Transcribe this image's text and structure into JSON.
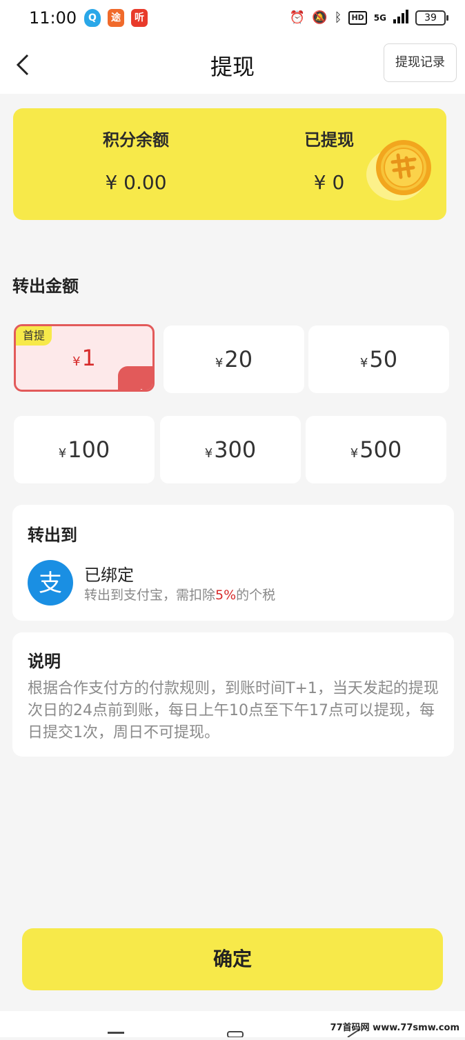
{
  "status_bar": {
    "time": "11:00",
    "apps": [
      {
        "label": "Q",
        "color": "#2aa7e8"
      },
      {
        "label": "途",
        "color": "#f06a2b"
      },
      {
        "label": "听",
        "color": "#e83a2b"
      }
    ],
    "hd": "HD",
    "network": "5G",
    "battery": "39"
  },
  "nav": {
    "title": "提现",
    "record_button": "提现记录"
  },
  "balance": {
    "points_label": "积分余额",
    "points_value": "¥ 0.00",
    "withdrawn_label": "已提现",
    "withdrawn_value": "¥ 0",
    "card_color": "#f7e94a"
  },
  "amount_section": {
    "title": "转出金额",
    "currency": "¥",
    "first_tag": "首提",
    "options": [
      "1",
      "20",
      "50",
      "100",
      "300",
      "500"
    ],
    "selected_index": 0
  },
  "transfer_to": {
    "title": "转出到",
    "bound_label": "已绑定",
    "note_prefix": "转出到支付宝，需扣除",
    "note_percent": "5%",
    "note_suffix": "的个税",
    "alipay_glyph": "支"
  },
  "description": {
    "title": "说明",
    "text": "根据合作支付方的付款规则，到账时间T+1，当天发起的提现次日的24点前到账，每日上午10点至下午17点可以提现，每日提交1次，周日不可提现。"
  },
  "confirm_button": "确定",
  "watermark": "77首码网 www.77smw.com"
}
